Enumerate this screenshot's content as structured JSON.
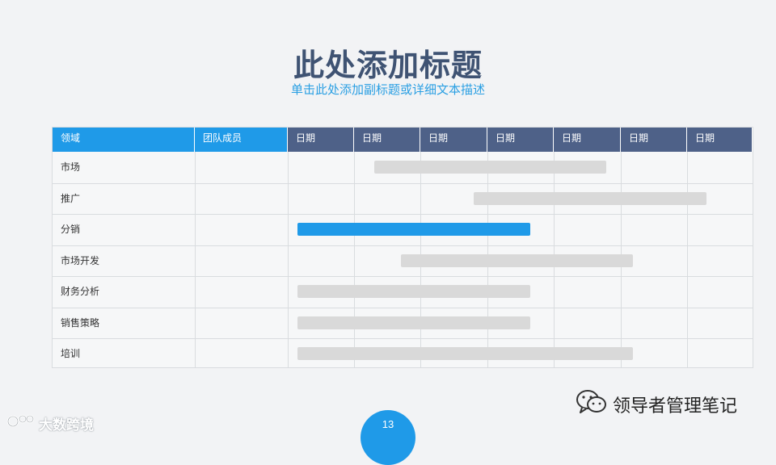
{
  "slide": {
    "title": "此处添加标题",
    "subtitle": "单击此处添加副标题或详细文本描述",
    "page_number": "13"
  },
  "gantt": {
    "headers": [
      "领域",
      "团队成员",
      "日期",
      "日期",
      "日期",
      "日期",
      "日期",
      "日期",
      "日期"
    ],
    "timeline_span": [
      0,
      7
    ],
    "rows": [
      {
        "label": "市场",
        "start": 1.3,
        "end": 4.8,
        "highlight": false
      },
      {
        "label": "推广",
        "start": 2.8,
        "end": 6.3,
        "highlight": false
      },
      {
        "label": "分销",
        "start": 0.15,
        "end": 3.65,
        "highlight": true
      },
      {
        "label": "市场开发",
        "start": 1.7,
        "end": 5.2,
        "highlight": false
      },
      {
        "label": "财务分析",
        "start": 0.15,
        "end": 3.65,
        "highlight": false
      },
      {
        "label": "销售策略",
        "start": 0.15,
        "end": 3.65,
        "highlight": false
      },
      {
        "label": "培训",
        "start": 0.15,
        "end": 5.2,
        "highlight": false
      }
    ],
    "colors": {
      "header_blue": "#1f9ae8",
      "header_navy": "#4e6188",
      "bar_default": "#d9d9d9",
      "bar_highlight": "#1f9ae8"
    }
  },
  "footer": {
    "wechat_label": "领导者管理笔记",
    "wechat_icon": "wechat-icon",
    "brand_label": "大数跨境",
    "brand_icon": "brand-logo-icon"
  }
}
